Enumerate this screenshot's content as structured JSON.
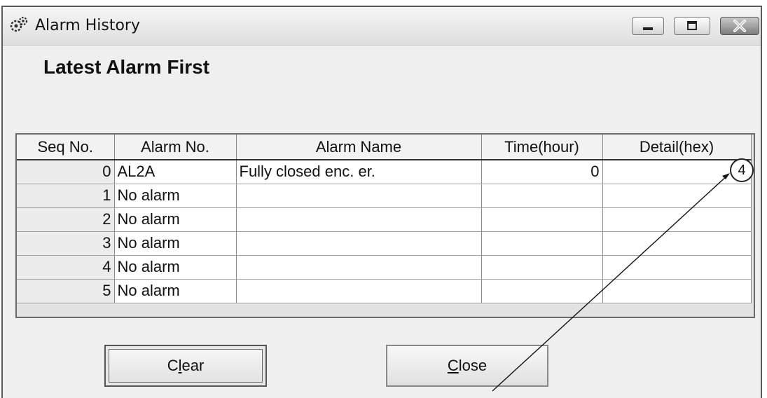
{
  "window": {
    "title": "Alarm History",
    "icons": {
      "app": "gear-pair-icon",
      "minimize": "minimize-icon",
      "maximize": "maximize-icon",
      "close": "close-icon"
    }
  },
  "heading": "Latest Alarm First",
  "table": {
    "columns": [
      "Seq No.",
      "Alarm No.",
      "Alarm Name",
      "Time(hour)",
      "Detail(hex)"
    ],
    "rows": [
      {
        "seq": "0",
        "alarm_no": "AL2A",
        "alarm_name": "Fully closed enc. er.",
        "time": "0",
        "detail": ""
      },
      {
        "seq": "1",
        "alarm_no": "No alarm",
        "alarm_name": "",
        "time": "",
        "detail": ""
      },
      {
        "seq": "2",
        "alarm_no": "No alarm",
        "alarm_name": "",
        "time": "",
        "detail": ""
      },
      {
        "seq": "3",
        "alarm_no": "No alarm",
        "alarm_name": "",
        "time": "",
        "detail": ""
      },
      {
        "seq": "4",
        "alarm_no": "No alarm",
        "alarm_name": "",
        "time": "",
        "detail": ""
      },
      {
        "seq": "5",
        "alarm_no": "No alarm",
        "alarm_name": "",
        "time": "",
        "detail": ""
      }
    ]
  },
  "buttons": {
    "clear": {
      "pre": "C",
      "accel": "l",
      "post": "ear"
    },
    "close": {
      "pre": "",
      "accel": "C",
      "post": "lose"
    }
  },
  "callout": {
    "label": "4"
  }
}
